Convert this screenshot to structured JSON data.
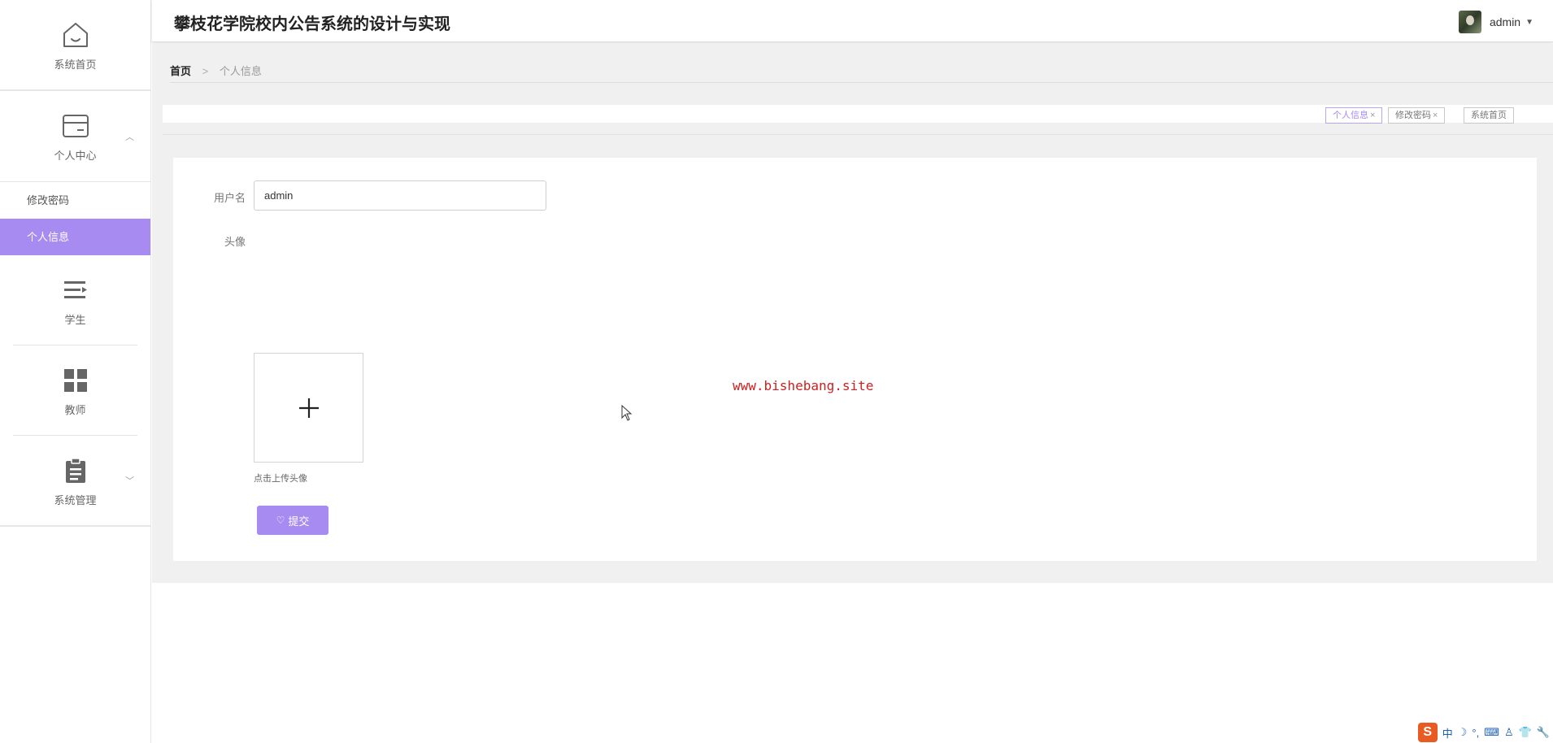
{
  "app": {
    "title": "攀枝花学院校内公告系统的设计与实现",
    "user": "admin"
  },
  "sidebar": {
    "home": {
      "label": "系统首页",
      "icon": "home-icon"
    },
    "personal_center": {
      "label": "个人中心",
      "icon": "card-icon",
      "expanded": true,
      "items": [
        {
          "label": "修改密码",
          "active": false
        },
        {
          "label": "个人信息",
          "active": true
        }
      ]
    },
    "student": {
      "label": "学生",
      "icon": "list-icon"
    },
    "teacher": {
      "label": "教师",
      "icon": "grid-icon"
    },
    "system": {
      "label": "系统管理",
      "icon": "clipboard-icon",
      "expanded": false
    }
  },
  "breadcrumb": {
    "home": "首页",
    "separator": ">",
    "current": "个人信息"
  },
  "tabs": [
    {
      "label": "个人信息",
      "closable": true,
      "active": true
    },
    {
      "label": "修改密码",
      "closable": true,
      "active": false
    },
    {
      "label": "系统首页",
      "closable": false,
      "active": false
    }
  ],
  "form": {
    "username_label": "用户名",
    "username_value": "admin",
    "avatar_label": "头像",
    "upload_hint": "点击上传头像",
    "submit_label": "提交"
  },
  "watermark": "www.bishebang.site",
  "tray": {
    "ime": "中"
  },
  "colors": {
    "accent": "#a78bf0",
    "watermark": "#cc2020"
  }
}
